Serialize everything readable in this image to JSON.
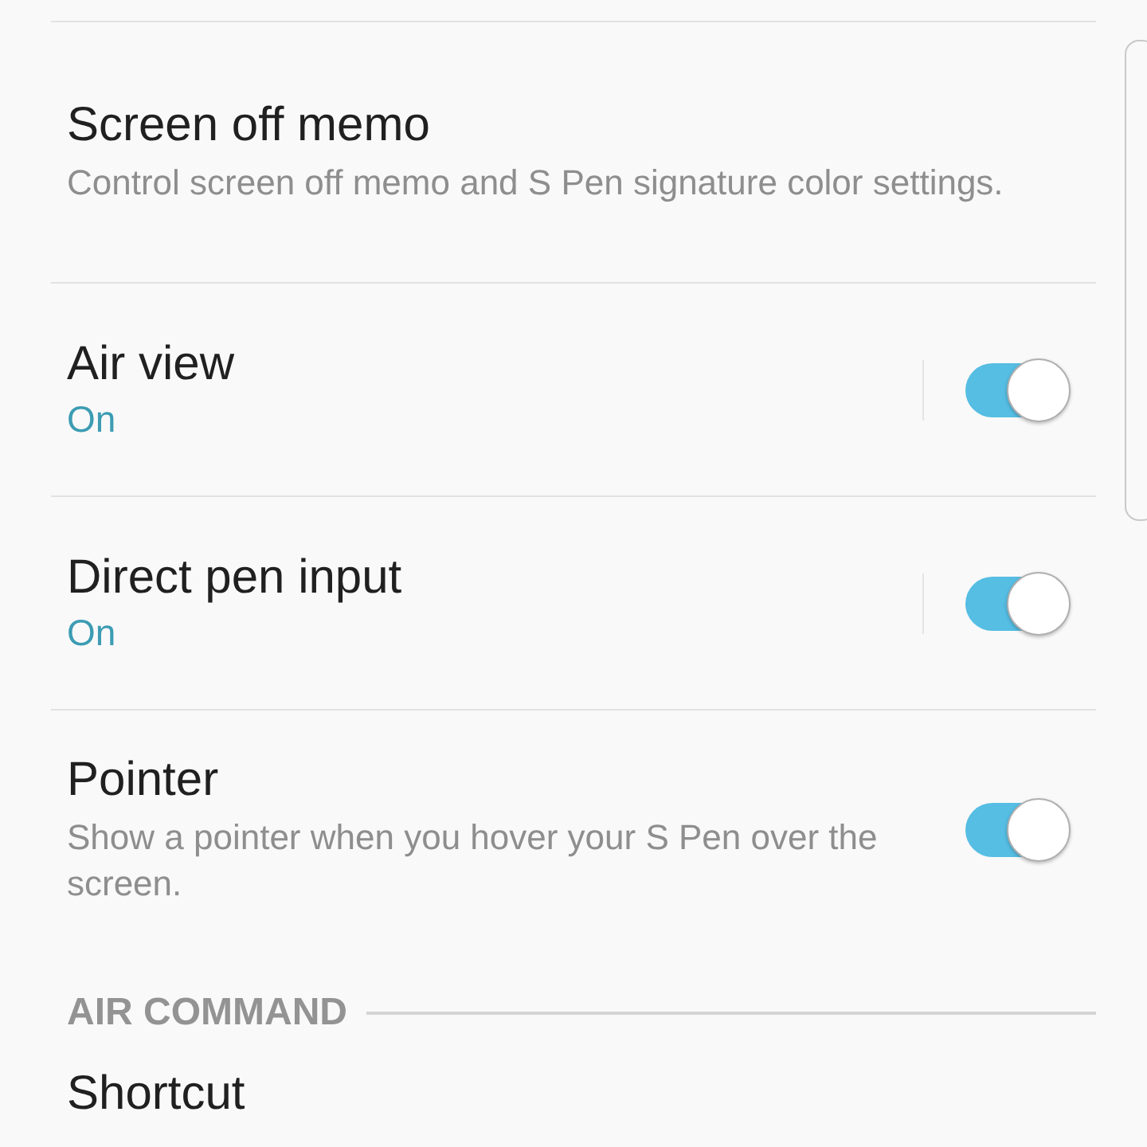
{
  "settings": [
    {
      "kind": "link",
      "title": "Screen off memo",
      "description": "Control screen off memo and S Pen signature color settings."
    },
    {
      "kind": "split_toggle",
      "title": "Air view",
      "status": "On",
      "on": true
    },
    {
      "kind": "split_toggle",
      "title": "Direct pen input",
      "status": "On",
      "on": true
    },
    {
      "kind": "toggle",
      "title": "Pointer",
      "description": "Show a pointer when you hover your S Pen over the screen.",
      "on": true
    }
  ],
  "section": {
    "header": "AIR COMMAND",
    "items": [
      {
        "title": "Shortcut"
      }
    ]
  }
}
